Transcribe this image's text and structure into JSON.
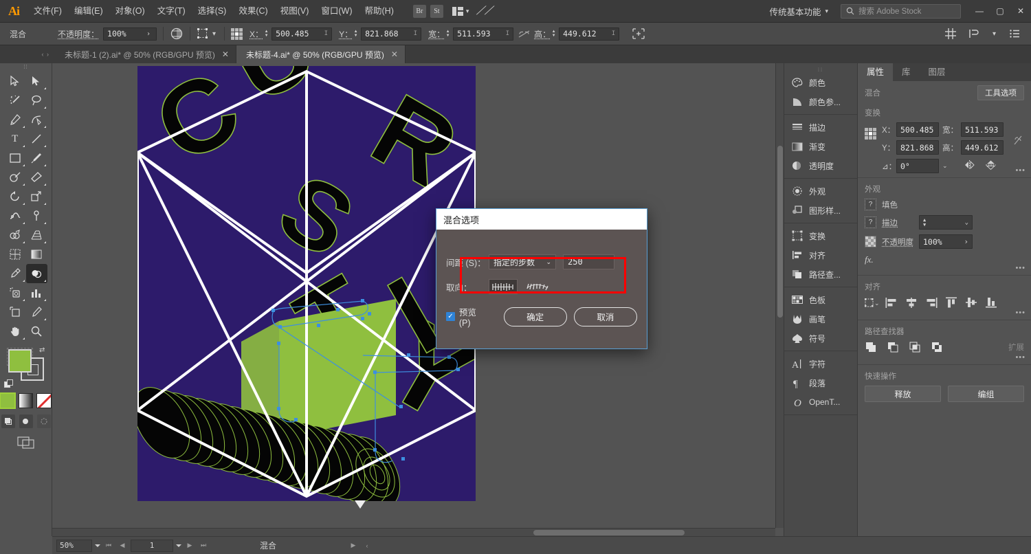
{
  "app": {
    "logo": "Ai",
    "title": "Adobe Illustrator"
  },
  "menubar": {
    "items": [
      {
        "label": "文件(F)",
        "name": "menu-file"
      },
      {
        "label": "编辑(E)",
        "name": "menu-edit"
      },
      {
        "label": "对象(O)",
        "name": "menu-object"
      },
      {
        "label": "文字(T)",
        "name": "menu-type"
      },
      {
        "label": "选择(S)",
        "name": "menu-select"
      },
      {
        "label": "效果(C)",
        "name": "menu-effect"
      },
      {
        "label": "视图(V)",
        "name": "menu-view"
      },
      {
        "label": "窗口(W)",
        "name": "menu-window"
      },
      {
        "label": "帮助(H)",
        "name": "menu-help"
      }
    ],
    "bridge_chip": "Br",
    "stock_chip": "St",
    "workspace": "传统基本功能",
    "search_placeholder": "搜索 Adobe Stock",
    "window_buttons": {
      "minimize": "—",
      "maximize": "▢",
      "close": "✕"
    }
  },
  "controlbar": {
    "object_type": "混合",
    "opacity_label": "不透明度：",
    "opacity_value": "100%",
    "x_label": "X：",
    "x_value": "500.485",
    "y_label": "Y：",
    "y_value": "821.868",
    "w_label": "宽：",
    "w_value": "511.593",
    "h_label": "高：",
    "h_value": "449.612"
  },
  "tabs": [
    {
      "label": "未标题-1 (2).ai* @ 50% (RGB/GPU 预览)",
      "active": false,
      "close": "✕"
    },
    {
      "label": "未标题-4.ai* @ 50% (RGB/GPU 预览)",
      "active": true,
      "close": "✕"
    }
  ],
  "toolbar": {
    "tools": [
      {
        "name": "selection-tool",
        "glyph": "sel"
      },
      {
        "name": "direct-selection-tool",
        "glyph": "dsel"
      },
      {
        "name": "magic-wand-tool",
        "glyph": "wand"
      },
      {
        "name": "lasso-tool",
        "glyph": "lasso"
      },
      {
        "name": "pen-tool",
        "glyph": "pen"
      },
      {
        "name": "curvature-tool",
        "glyph": "curv"
      },
      {
        "name": "type-tool",
        "glyph": "T"
      },
      {
        "name": "line-segment-tool",
        "glyph": "line"
      },
      {
        "name": "rectangle-tool",
        "glyph": "rect"
      },
      {
        "name": "paintbrush-tool",
        "glyph": "brush"
      },
      {
        "name": "shaper-tool",
        "glyph": "shaper"
      },
      {
        "name": "eraser-tool",
        "glyph": "eraser"
      },
      {
        "name": "rotate-tool",
        "glyph": "rotate"
      },
      {
        "name": "scale-tool",
        "glyph": "scale"
      },
      {
        "name": "width-tool",
        "glyph": "width"
      },
      {
        "name": "free-transform-tool",
        "glyph": "pin"
      },
      {
        "name": "shape-builder-tool",
        "glyph": "shapebuild"
      },
      {
        "name": "perspective-grid-tool",
        "glyph": "persp"
      },
      {
        "name": "mesh-tool",
        "glyph": "mesh"
      },
      {
        "name": "gradient-tool",
        "glyph": "grad"
      },
      {
        "name": "eyedropper-tool",
        "glyph": "eyedrop"
      },
      {
        "name": "blend-tool",
        "glyph": "blend",
        "selected": true
      },
      {
        "name": "symbol-sprayer-tool",
        "glyph": "spray"
      },
      {
        "name": "column-graph-tool",
        "glyph": "graph"
      },
      {
        "name": "artboard-tool",
        "glyph": "artboard"
      },
      {
        "name": "slice-tool",
        "glyph": "slice"
      },
      {
        "name": "hand-tool",
        "glyph": "hand"
      },
      {
        "name": "zoom-tool",
        "glyph": "zoom"
      }
    ],
    "fill_color": "#8fbf3f",
    "stroke_color": "#ffffff",
    "swatch_fill": "#8fbf3f",
    "swatch_gradient": "gradient",
    "swatch_none": "none"
  },
  "canvas": {
    "artboard_background": "#2d1b6b",
    "accent_green": "#8fbf3f",
    "stroke_white": "#ffffff",
    "selection_blue": "#3d8fe0",
    "letters": [
      "C",
      "U",
      "R",
      "S",
      "I",
      "T",
      "Y"
    ],
    "zoom": "50%"
  },
  "dialog": {
    "title": "混合选项",
    "spacing_label": "间距 (S)：",
    "spacing_mode": "指定的步数",
    "spacing_value": "250",
    "orientation_label": "取向：",
    "orientation_options": [
      "align-to-page",
      "align-to-path"
    ],
    "orientation_selected": 0,
    "preview_label": "预览 (P)",
    "preview_checked": true,
    "ok_label": "确定",
    "cancel_label": "取消",
    "highlight_color": "#ff0000",
    "border_color": "#5a9fd4"
  },
  "dock": {
    "groups": [
      {
        "items": [
          {
            "label": "颜色",
            "icon": "color-palette-icon"
          },
          {
            "label": "颜色参...",
            "icon": "color-guide-icon"
          }
        ]
      },
      {
        "items": [
          {
            "label": "描边",
            "icon": "stroke-icon"
          },
          {
            "label": "渐变",
            "icon": "gradient-icon"
          },
          {
            "label": "透明度",
            "icon": "transparency-icon"
          }
        ]
      },
      {
        "items": [
          {
            "label": "外观",
            "icon": "appearance-icon"
          },
          {
            "label": "图形样...",
            "icon": "graphic-styles-icon"
          }
        ]
      },
      {
        "items": [
          {
            "label": "变换",
            "icon": "transform-icon"
          },
          {
            "label": "对齐",
            "icon": "align-icon"
          },
          {
            "label": "路径查...",
            "icon": "pathfinder-icon"
          }
        ]
      },
      {
        "items": [
          {
            "label": "色板",
            "icon": "swatches-icon"
          },
          {
            "label": "画笔",
            "icon": "brushes-icon"
          },
          {
            "label": "符号",
            "icon": "symbols-icon"
          }
        ]
      },
      {
        "items": [
          {
            "label": "字符",
            "icon": "character-icon"
          },
          {
            "label": "段落",
            "icon": "paragraph-icon"
          },
          {
            "label": "OpenT...",
            "icon": "opentype-icon"
          }
        ]
      }
    ]
  },
  "properties": {
    "tabs": [
      {
        "label": "属性",
        "active": true
      },
      {
        "label": "库",
        "active": false
      },
      {
        "label": "图层",
        "active": false
      }
    ],
    "object_label": "混合",
    "tool_options_btn": "工具选项",
    "transform": {
      "heading": "变换",
      "x_label": "X：",
      "x_value": "500.485",
      "y_label": "Y：",
      "y_value": "821.868",
      "w_label": "宽：",
      "w_value": "511.593",
      "h_label": "高：",
      "h_value": "449.612",
      "angle_label": "⊿：",
      "angle_value": "0°",
      "dots": "•••"
    },
    "appearance": {
      "heading": "外观",
      "fill_label": "填色",
      "stroke_label": "描边",
      "stroke_weight": "",
      "opacity_label": "不透明度",
      "opacity_value": "100%",
      "fx_label": "fx.",
      "dots": "•••"
    },
    "align": {
      "heading": "对齐",
      "dots": "•••"
    },
    "pathfinder": {
      "heading": "路径查找器",
      "merge_label": "扩展",
      "dots": "•••"
    },
    "quick_actions": {
      "heading": "快速操作",
      "release_label": "释放",
      "expand_label": "编组"
    }
  },
  "statusbar": {
    "zoom": "50%",
    "artboard_number": "1",
    "status_text": "混合"
  }
}
